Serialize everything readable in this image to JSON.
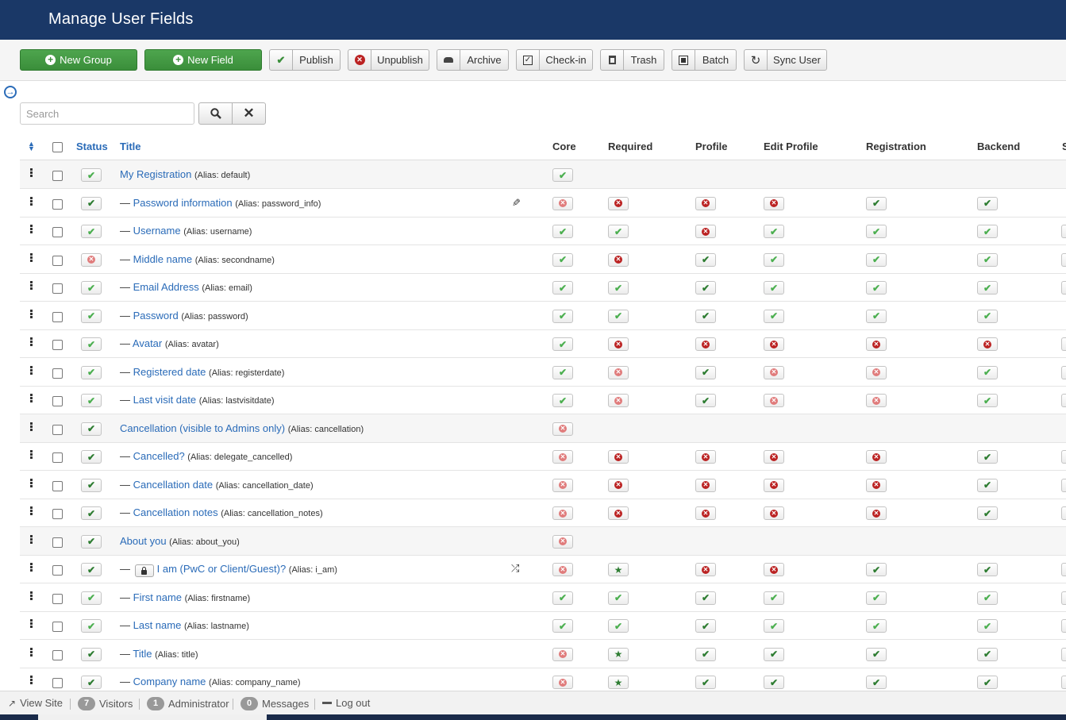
{
  "header": {
    "title": "Manage User Fields"
  },
  "toolbar": {
    "new_group": "New Group",
    "new_field": "New Field",
    "publish": "Publish",
    "unpublish": "Unpublish",
    "archive": "Archive",
    "checkin": "Check-in",
    "trash": "Trash",
    "batch": "Batch",
    "sync_user": "Sync User"
  },
  "search": {
    "placeholder": "Search"
  },
  "columns": {
    "status": "Status",
    "title": "Title",
    "core": "Core",
    "required": "Required",
    "profile": "Profile",
    "edit_profile": "Edit Profile",
    "registration": "Registration",
    "backend": "Backend",
    "extra": "S"
  },
  "status_legend": {
    "ok": "published (light check)",
    "okb": "published (dark check)",
    "no": "unpublished (light x)",
    "nob": "unpublished (dark x)",
    "star": "required star"
  },
  "rows": [
    {
      "group": true,
      "title": "My Registration",
      "alias": "(Alias: default)",
      "status": "ok",
      "core": "ok",
      "required": "",
      "profile": "",
      "edit_profile": "",
      "registration": "",
      "backend": "",
      "extra": ""
    },
    {
      "group": false,
      "title": "Password information",
      "alias": "(Alias: password_info)",
      "icon": "brush",
      "status": "okb",
      "core": "no",
      "required": "nob",
      "profile": "nob",
      "edit_profile": "nob",
      "registration": "okb",
      "backend": "okb",
      "extra": ""
    },
    {
      "group": false,
      "title": "Username",
      "alias": "(Alias: username)",
      "status": "ok",
      "core": "ok",
      "required": "ok",
      "profile": "nob",
      "edit_profile": "ok",
      "registration": "ok",
      "backend": "ok",
      "extra": "cut"
    },
    {
      "group": false,
      "title": "Middle name",
      "alias": "(Alias: secondname)",
      "status": "no",
      "core": "ok",
      "required": "nob",
      "profile": "okb",
      "edit_profile": "ok",
      "registration": "ok",
      "backend": "ok",
      "extra": "cut"
    },
    {
      "group": false,
      "title": "Email Address",
      "alias": "(Alias: email)",
      "status": "ok",
      "core": "ok",
      "required": "ok",
      "profile": "okb",
      "edit_profile": "ok",
      "registration": "ok",
      "backend": "ok",
      "extra": "cut"
    },
    {
      "group": false,
      "title": "Password",
      "alias": "(Alias: password)",
      "status": "ok",
      "core": "ok",
      "required": "ok",
      "profile": "okb",
      "edit_profile": "ok",
      "registration": "ok",
      "backend": "ok",
      "extra": ""
    },
    {
      "group": false,
      "title": "Avatar",
      "alias": "(Alias: avatar)",
      "status": "ok",
      "core": "ok",
      "required": "nob",
      "profile": "nob",
      "edit_profile": "nob",
      "registration": "nob",
      "backend": "nob",
      "extra": "cut"
    },
    {
      "group": false,
      "title": "Registered date",
      "alias": "(Alias: registerdate)",
      "status": "ok",
      "core": "ok",
      "required": "no",
      "profile": "okb",
      "edit_profile": "no",
      "registration": "no",
      "backend": "ok",
      "extra": "cut"
    },
    {
      "group": false,
      "title": "Last visit date",
      "alias": "(Alias: lastvisitdate)",
      "status": "ok",
      "core": "ok",
      "required": "no",
      "profile": "okb",
      "edit_profile": "no",
      "registration": "no",
      "backend": "ok",
      "extra": "cut"
    },
    {
      "group": true,
      "title": "Cancellation (visible to Admins only)",
      "alias": "(Alias: cancellation)",
      "status": "okb",
      "core": "no",
      "required": "",
      "profile": "",
      "edit_profile": "",
      "registration": "",
      "backend": "",
      "extra": ""
    },
    {
      "group": false,
      "title": "Cancelled?",
      "alias": "(Alias: delegate_cancelled)",
      "status": "okb",
      "core": "no",
      "required": "nob",
      "profile": "nob",
      "edit_profile": "nob",
      "registration": "nob",
      "backend": "okb",
      "extra": "cut"
    },
    {
      "group": false,
      "title": "Cancellation date",
      "alias": "(Alias: cancellation_date)",
      "status": "okb",
      "core": "no",
      "required": "nob",
      "profile": "nob",
      "edit_profile": "nob",
      "registration": "nob",
      "backend": "okb",
      "extra": "cut"
    },
    {
      "group": false,
      "title": "Cancellation notes",
      "alias": "(Alias: cancellation_notes)",
      "status": "okb",
      "core": "no",
      "required": "nob",
      "profile": "nob",
      "edit_profile": "nob",
      "registration": "nob",
      "backend": "okb",
      "extra": "cut"
    },
    {
      "group": true,
      "title": "About you",
      "alias": "(Alias: about_you)",
      "status": "okb",
      "core": "no",
      "required": "",
      "profile": "",
      "edit_profile": "",
      "registration": "",
      "backend": "",
      "extra": ""
    },
    {
      "group": false,
      "title": "I am (PwC or Client/Guest)?",
      "alias": "(Alias: i_am)",
      "lock": true,
      "icon": "shuffle",
      "status": "okb",
      "core": "no",
      "required": "star",
      "profile": "nob",
      "edit_profile": "nob",
      "registration": "okb",
      "backend": "okb",
      "extra": "cut"
    },
    {
      "group": false,
      "title": "First name",
      "alias": "(Alias: firstname)",
      "status": "ok",
      "core": "ok",
      "required": "ok",
      "profile": "okb",
      "edit_profile": "ok",
      "registration": "ok",
      "backend": "ok",
      "extra": "cut"
    },
    {
      "group": false,
      "title": "Last name",
      "alias": "(Alias: lastname)",
      "status": "ok",
      "core": "ok",
      "required": "ok",
      "profile": "okb",
      "edit_profile": "ok",
      "registration": "ok",
      "backend": "ok",
      "extra": "cut"
    },
    {
      "group": false,
      "title": "Title",
      "alias": "(Alias: title)",
      "status": "okb",
      "core": "no",
      "required": "star",
      "profile": "okb",
      "edit_profile": "okb",
      "registration": "okb",
      "backend": "okb",
      "extra": "cut"
    },
    {
      "group": false,
      "title": "Company name",
      "alias": "(Alias: company_name)",
      "status": "okb",
      "core": "no",
      "required": "star",
      "profile": "okb",
      "edit_profile": "okb",
      "registration": "okb",
      "backend": "okb",
      "extra": "cut"
    }
  ],
  "status_bar": {
    "view_site": "View Site",
    "visitors_count": "7",
    "visitors_label": "Visitors",
    "admin_count": "1",
    "admin_label": "Administrator",
    "messages_count": "0",
    "messages_label": "Messages",
    "logout": "Log out"
  },
  "colors": {
    "header": "#1a3867",
    "link": "#2a6bb8",
    "green_button": "#3f963f"
  }
}
